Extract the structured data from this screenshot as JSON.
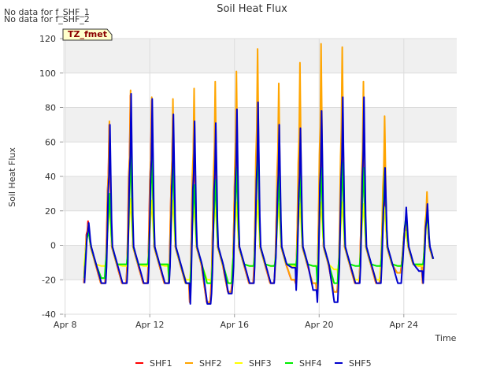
{
  "chart_data": {
    "type": "line",
    "title": "Soil Heat Flux",
    "xlabel": "Time",
    "ylabel": "Soil Heat Flux",
    "no_data_messages": [
      "No data for f_SHF_1",
      "No data for f_SHF_2"
    ],
    "tag_label": "TZ_fmet",
    "xlim": [
      7.9,
      26.5
    ],
    "ylim": [
      -40,
      120
    ],
    "x_ticks": [
      {
        "value": 8,
        "label": "Apr 8"
      },
      {
        "value": 12,
        "label": "Apr 12"
      },
      {
        "value": 16,
        "label": "Apr 16"
      },
      {
        "value": 20,
        "label": "Apr 20"
      },
      {
        "value": 24,
        "label": "Apr 24"
      }
    ],
    "y_ticks": [
      -40,
      -20,
      0,
      20,
      40,
      60,
      80,
      100,
      120
    ],
    "grid": true,
    "legend_position": "bottom-center",
    "days": [
      {
        "day": 8.9,
        "peak": {
          "SHF1": 14,
          "SHF2": 12,
          "SHF3": 10,
          "SHF4": 8,
          "SHF5": 13
        },
        "min": {
          "SHF1": -22,
          "SHF2": -22,
          "SHF3": -12,
          "SHF4": -19,
          "SHF5": -22
        }
      },
      {
        "day": 9.9,
        "peak": {
          "SHF1": 70,
          "SHF2": 72,
          "SHF3": 24,
          "SHF4": 30,
          "SHF5": 70
        },
        "min": {
          "SHF1": -22,
          "SHF2": -22,
          "SHF3": -12,
          "SHF4": -11,
          "SHF5": -22
        }
      },
      {
        "day": 10.9,
        "peak": {
          "SHF1": 87,
          "SHF2": 90,
          "SHF3": 27,
          "SHF4": 55,
          "SHF5": 88
        },
        "min": {
          "SHF1": -22,
          "SHF2": -22,
          "SHF3": -12,
          "SHF4": -11,
          "SHF5": -22
        }
      },
      {
        "day": 11.9,
        "peak": {
          "SHF1": 84,
          "SHF2": 86,
          "SHF3": 26,
          "SHF4": 52,
          "SHF5": 85
        },
        "min": {
          "SHF1": -22,
          "SHF2": -22,
          "SHF3": -12,
          "SHF4": -11,
          "SHF5": -22
        }
      },
      {
        "day": 12.9,
        "peak": {
          "SHF1": 74,
          "SHF2": 85,
          "SHF3": 26,
          "SHF4": 48,
          "SHF5": 76
        },
        "min": {
          "SHF1": -22,
          "SHF2": -22,
          "SHF3": -20,
          "SHF4": -22,
          "SHF5": -22
        }
      },
      {
        "day": 13.9,
        "peak": {
          "SHF1": 70,
          "SHF2": 91,
          "SHF3": 24,
          "SHF4": 35,
          "SHF5": 72
        },
        "min": {
          "SHF1": -33,
          "SHF2": -33,
          "SHF3": -20,
          "SHF4": -22,
          "SHF5": -34
        }
      },
      {
        "day": 14.9,
        "peak": {
          "SHF1": 75,
          "SHF2": 95,
          "SHF3": 25,
          "SHF4": 38,
          "SHF5": 71
        },
        "min": {
          "SHF1": -27,
          "SHF2": -27,
          "SHF3": -22,
          "SHF4": -22,
          "SHF5": -28
        }
      },
      {
        "day": 15.9,
        "peak": {
          "SHF1": 75,
          "SHF2": 101,
          "SHF3": 25,
          "SHF4": 45,
          "SHF5": 79
        },
        "min": {
          "SHF1": -22,
          "SHF2": -22,
          "SHF3": -12,
          "SHF4": -12,
          "SHF5": -22
        }
      },
      {
        "day": 16.9,
        "peak": {
          "SHF1": 80,
          "SHF2": 114,
          "SHF3": 26,
          "SHF4": 60,
          "SHF5": 83
        },
        "min": {
          "SHF1": -22,
          "SHF2": -22,
          "SHF3": -12,
          "SHF4": -12,
          "SHF5": -22
        }
      },
      {
        "day": 17.9,
        "peak": {
          "SHF1": 68,
          "SHF2": 94,
          "SHF3": 24,
          "SHF4": 40,
          "SHF5": 70
        },
        "min": {
          "SHF1": -20,
          "SHF2": -20,
          "SHF3": -12,
          "SHF4": -11,
          "SHF5": -13
        }
      },
      {
        "day": 18.9,
        "peak": {
          "SHF1": 66,
          "SHF2": 106,
          "SHF3": 24,
          "SHF4": 42,
          "SHF5": 68
        },
        "min": {
          "SHF1": -22,
          "SHF2": -22,
          "SHF3": -12,
          "SHF4": -12,
          "SHF5": -26
        }
      },
      {
        "day": 19.9,
        "peak": {
          "SHF1": 75,
          "SHF2": 117,
          "SHF3": 25,
          "SHF4": 45,
          "SHF5": 78
        },
        "min": {
          "SHF1": -27,
          "SHF2": -27,
          "SHF3": -14,
          "SHF4": -22,
          "SHF5": -33
        }
      },
      {
        "day": 20.9,
        "peak": {
          "SHF1": 67,
          "SHF2": 115,
          "SHF3": 25,
          "SHF4": 48,
          "SHF5": 86
        },
        "min": {
          "SHF1": -22,
          "SHF2": -22,
          "SHF3": -20,
          "SHF4": -12,
          "SHF5": -22
        }
      },
      {
        "day": 21.9,
        "peak": {
          "SHF1": 68,
          "SHF2": 95,
          "SHF3": 24,
          "SHF4": 45,
          "SHF5": 86
        },
        "min": {
          "SHF1": -22,
          "SHF2": -22,
          "SHF3": -20,
          "SHF4": -12,
          "SHF5": -22
        }
      },
      {
        "day": 22.9,
        "peak": {
          "SHF1": 47,
          "SHF2": 75,
          "SHF3": 22,
          "SHF4": 45,
          "SHF5": 45
        },
        "min": {
          "SHF1": -16,
          "SHF2": -16,
          "SHF3": -12,
          "SHF4": -12,
          "SHF5": -22
        }
      },
      {
        "day": 23.9,
        "peak": {
          "SHF1": 12,
          "SHF2": 15,
          "SHF3": 8,
          "SHF4": 18,
          "SHF5": 22
        },
        "min": {
          "SHF1": -12,
          "SHF2": -12,
          "SHF3": -12,
          "SHF4": -11,
          "SHF5": -15
        }
      },
      {
        "day": 24.9,
        "peak": {
          "SHF1": 22,
          "SHF2": 31,
          "SHF3": 15,
          "SHF4": 20,
          "SHF5": 24
        },
        "min": {
          "SHF1": -22,
          "SHF2": -22,
          "SHF3": -12,
          "SHF4": -11,
          "SHF5": -22
        }
      }
    ],
    "end_day": 25.4,
    "series": [
      {
        "name": "SHF1",
        "color": "#ff0000"
      },
      {
        "name": "SHF2",
        "color": "#ffa500"
      },
      {
        "name": "SHF3",
        "color": "#ffff00"
      },
      {
        "name": "SHF4",
        "color": "#00ee00"
      },
      {
        "name": "SHF5",
        "color": "#0000cc"
      }
    ]
  }
}
